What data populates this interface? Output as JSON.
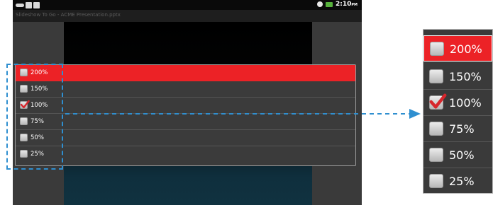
{
  "status_bar": {
    "time": "2:10",
    "ampm": "PM"
  },
  "title_bar": {
    "text": "Slideshow To Go - ACME Presentation.pptx"
  },
  "zoom_menu": {
    "items": [
      {
        "label": "200%",
        "checked": false,
        "highlighted": true
      },
      {
        "label": "150%",
        "checked": false,
        "highlighted": false
      },
      {
        "label": "100%",
        "checked": true,
        "highlighted": false
      },
      {
        "label": "75%",
        "checked": false,
        "highlighted": false
      },
      {
        "label": "50%",
        "checked": false,
        "highlighted": false
      },
      {
        "label": "25%",
        "checked": false,
        "highlighted": false
      }
    ]
  },
  "colors": {
    "highlight": "#ec2226",
    "callout": "#2f8fd0",
    "checkmark": "#d7262c",
    "status_battery": "#57b23c"
  }
}
